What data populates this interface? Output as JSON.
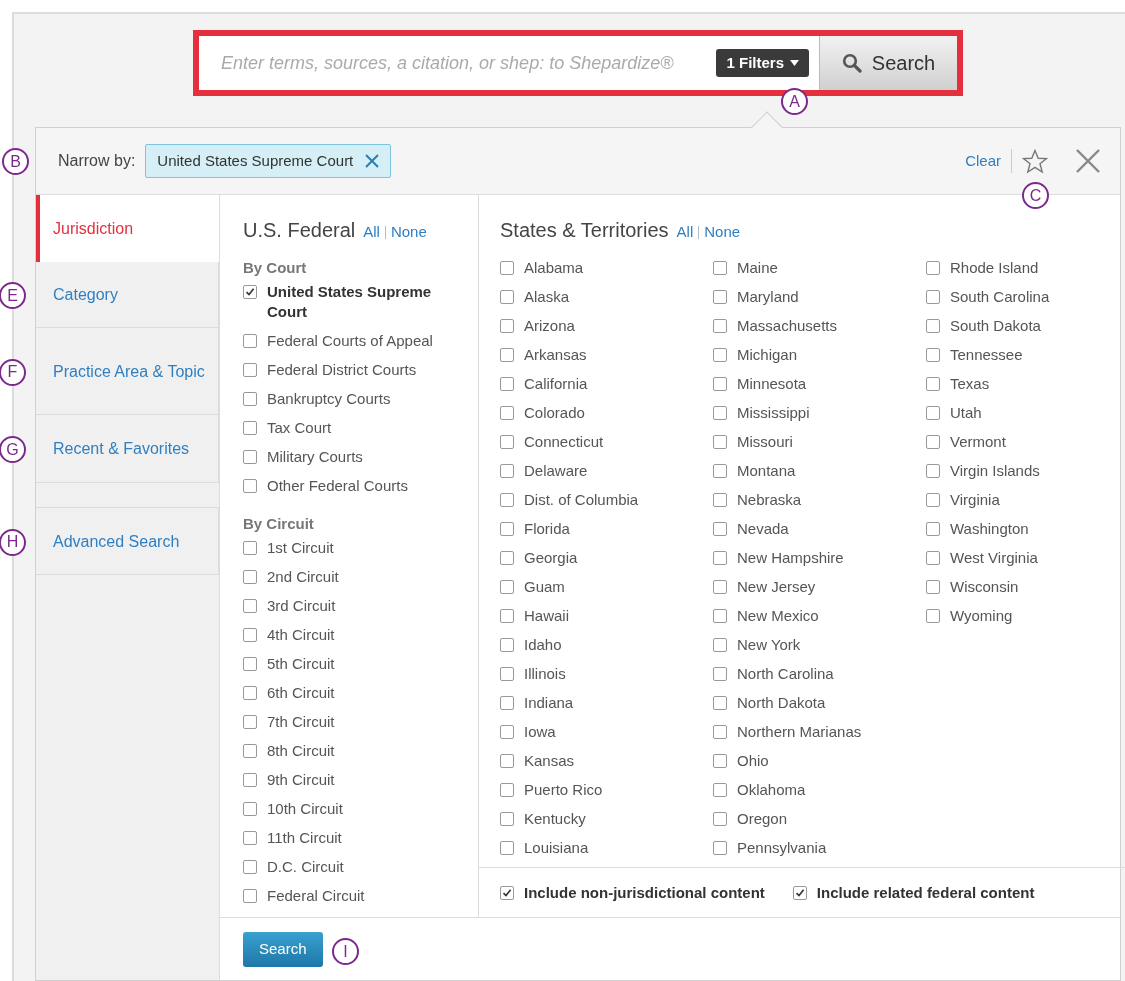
{
  "search": {
    "placeholder": "Enter terms, sources, a citation, or shep: to Shepardize®",
    "filter_button": "1 Filters",
    "button": "Search",
    "callout": "A"
  },
  "narrow": {
    "label": "Narrow by:",
    "chips": [
      {
        "label": "United States Supreme Court"
      }
    ],
    "clear": "Clear",
    "favorite": false,
    "callout": "B",
    "actions_callout": "C"
  },
  "sidebar": {
    "items": [
      {
        "label": "Jurisdiction",
        "selected": true
      },
      {
        "label": "Category",
        "selected": false,
        "callout": "E"
      },
      {
        "label": "Practice Area & Topic",
        "selected": false,
        "callout": "F"
      },
      {
        "label": "Recent & Favorites",
        "selected": false,
        "callout": "G"
      },
      {
        "kind": "spacer"
      },
      {
        "label": "Advanced Search",
        "selected": false,
        "callout": "H"
      }
    ]
  },
  "federal": {
    "title": "U.S. Federal",
    "all": "All",
    "none": "None",
    "groups": [
      {
        "heading": "By Court",
        "items": [
          {
            "label": "United States Supreme Court",
            "checked": true
          },
          {
            "label": "Federal Courts of Appeal",
            "checked": false
          },
          {
            "label": "Federal District Courts",
            "checked": false
          },
          {
            "label": "Bankruptcy Courts",
            "checked": false
          },
          {
            "label": "Tax Court",
            "checked": false
          },
          {
            "label": "Military Courts",
            "checked": false
          },
          {
            "label": "Other Federal Courts",
            "checked": false
          }
        ]
      },
      {
        "heading": "By Circuit",
        "items": [
          {
            "label": "1st Circuit",
            "checked": false
          },
          {
            "label": "2nd Circuit",
            "checked": false
          },
          {
            "label": "3rd Circuit",
            "checked": false
          },
          {
            "label": "4th Circuit",
            "checked": false
          },
          {
            "label": "5th Circuit",
            "checked": false
          },
          {
            "label": "6th Circuit",
            "checked": false
          },
          {
            "label": "7th Circuit",
            "checked": false
          },
          {
            "label": "8th Circuit",
            "checked": false
          },
          {
            "label": "9th Circuit",
            "checked": false
          },
          {
            "label": "10th Circuit",
            "checked": false
          },
          {
            "label": "11th Circuit",
            "checked": false
          },
          {
            "label": "D.C. Circuit",
            "checked": false
          },
          {
            "label": "Federal Circuit",
            "checked": false
          }
        ]
      }
    ]
  },
  "states": {
    "title": "States & Territories",
    "all": "All",
    "none": "None",
    "columns": [
      [
        {
          "label": "Alabama",
          "checked": false
        },
        {
          "label": "Alaska",
          "checked": false
        },
        {
          "label": "Arizona",
          "checked": false
        },
        {
          "label": "Arkansas",
          "checked": false
        },
        {
          "label": "California",
          "checked": false
        },
        {
          "label": "Colorado",
          "checked": false
        },
        {
          "label": "Connecticut",
          "checked": false
        },
        {
          "label": "Delaware",
          "checked": false
        },
        {
          "label": "Dist. of Columbia",
          "checked": false
        },
        {
          "label": "Florida",
          "checked": false
        },
        {
          "label": "Georgia",
          "checked": false
        },
        {
          "label": "Guam",
          "checked": false
        },
        {
          "label": "Hawaii",
          "checked": false
        },
        {
          "label": "Idaho",
          "checked": false
        },
        {
          "label": "Illinois",
          "checked": false
        },
        {
          "label": "Indiana",
          "checked": false
        },
        {
          "label": "Iowa",
          "checked": false
        },
        {
          "label": "Kansas",
          "checked": false
        },
        {
          "label": "Puerto Rico",
          "checked": false
        },
        {
          "label": "Kentucky",
          "checked": false
        },
        {
          "label": "Louisiana",
          "checked": false
        }
      ],
      [
        {
          "label": "Maine",
          "checked": false
        },
        {
          "label": "Maryland",
          "checked": false
        },
        {
          "label": "Massachusetts",
          "checked": false
        },
        {
          "label": "Michigan",
          "checked": false
        },
        {
          "label": "Minnesota",
          "checked": false
        },
        {
          "label": "Mississippi",
          "checked": false
        },
        {
          "label": "Missouri",
          "checked": false
        },
        {
          "label": "Montana",
          "checked": false
        },
        {
          "label": "Nebraska",
          "checked": false
        },
        {
          "label": "Nevada",
          "checked": false
        },
        {
          "label": "New Hampshire",
          "checked": false
        },
        {
          "label": "New Jersey",
          "checked": false
        },
        {
          "label": "New Mexico",
          "checked": false
        },
        {
          "label": "New York",
          "checked": false
        },
        {
          "label": "North Carolina",
          "checked": false
        },
        {
          "label": "North Dakota",
          "checked": false
        },
        {
          "label": "Northern Marianas",
          "checked": false
        },
        {
          "label": "Ohio",
          "checked": false
        },
        {
          "label": "Oklahoma",
          "checked": false
        },
        {
          "label": "Oregon",
          "checked": false
        },
        {
          "label": "Pennsylvania",
          "checked": false
        }
      ],
      [
        {
          "label": "Rhode Island",
          "checked": false
        },
        {
          "label": "South Carolina",
          "checked": false
        },
        {
          "label": "South Dakota",
          "checked": false
        },
        {
          "label": "Tennessee",
          "checked": false
        },
        {
          "label": "Texas",
          "checked": false
        },
        {
          "label": "Utah",
          "checked": false
        },
        {
          "label": "Vermont",
          "checked": false
        },
        {
          "label": "Virgin Islands",
          "checked": false
        },
        {
          "label": "Virginia",
          "checked": false
        },
        {
          "label": "Washington",
          "checked": false
        },
        {
          "label": "West Virginia",
          "checked": false
        },
        {
          "label": "Wisconsin",
          "checked": false
        },
        {
          "label": "Wyoming",
          "checked": false
        }
      ]
    ],
    "options": [
      {
        "label": "Include non-jurisdictional content",
        "checked": true
      },
      {
        "label": "Include related federal content",
        "checked": true
      }
    ]
  },
  "footer": {
    "button": "Search",
    "callout": "I"
  }
}
